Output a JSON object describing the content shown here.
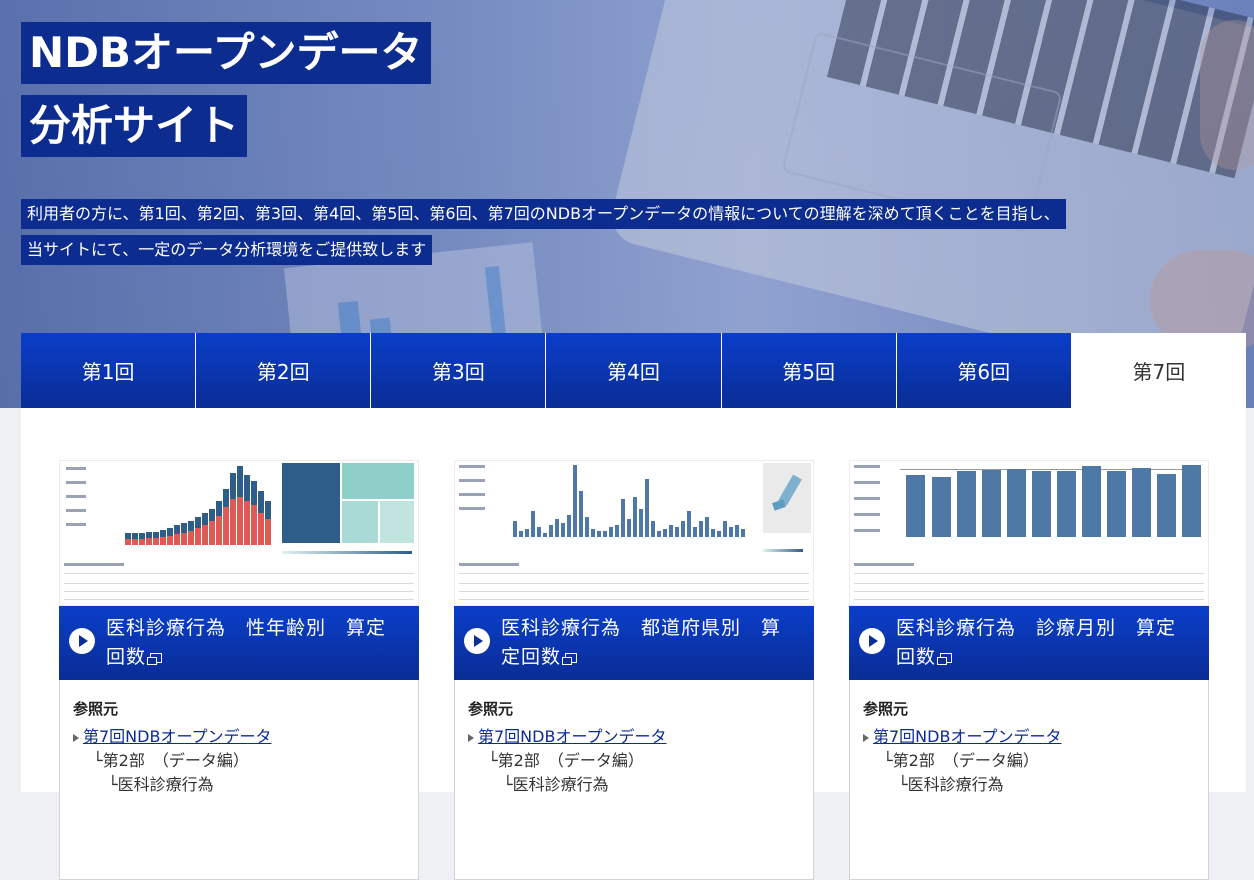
{
  "hero": {
    "title_line1": "NDBオープンデータ",
    "title_line2": "分析サイト",
    "description_line1": "利用者の方に、第1回、第2回、第3回、第4回、第5回、第6回、第7回のNDBオープンデータの情報についての理解を深めて頂くことを目指し、",
    "description_line2": "当サイトにて、一定のデータ分析環境をご提供致します"
  },
  "tabs": [
    {
      "label": "第1回",
      "active": false
    },
    {
      "label": "第2回",
      "active": false
    },
    {
      "label": "第3回",
      "active": false
    },
    {
      "label": "第4回",
      "active": false
    },
    {
      "label": "第5回",
      "active": false
    },
    {
      "label": "第6回",
      "active": false
    },
    {
      "label": "第7回",
      "active": true
    }
  ],
  "cards": [
    {
      "title": "医科診療行為　性年齢別　算定回数",
      "ref_label": "参照元",
      "ref_link": "第7回NDBオープンデータ",
      "ref_sub1": "└第2部　（データ編）",
      "ref_sub2": "└医科診療行為",
      "thumb_icon": "bar-chart-thumbnail"
    },
    {
      "title": "医科診療行為　都道府県別　算定回数",
      "ref_label": "参照元",
      "ref_link": "第7回NDBオープンデータ",
      "ref_sub1": "└第2部　（データ編）",
      "ref_sub2": "└医科診療行為",
      "thumb_icon": "prefecture-chart-thumbnail"
    },
    {
      "title": "医科診療行為　診療月別　算定回数",
      "ref_label": "参照元",
      "ref_link": "第7回NDBオープンデータ",
      "ref_sub1": "└第2部　（データ編）",
      "ref_sub2": "└医科診療行為",
      "thumb_icon": "monthly-chart-thumbnail"
    }
  ],
  "colors": {
    "brand_blue": "#0a2d96",
    "title_bg": "#0d2c8f",
    "link": "#0d2c8f"
  }
}
